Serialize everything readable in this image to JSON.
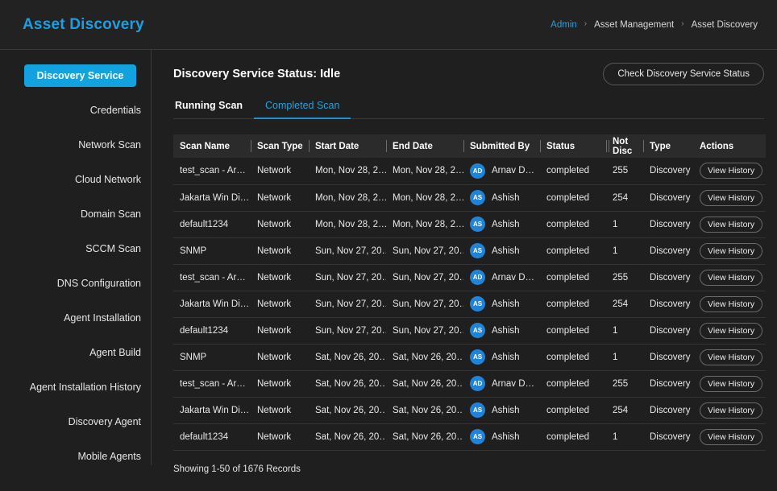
{
  "app": {
    "title": "Asset Discovery"
  },
  "breadcrumb": {
    "items": [
      "Admin",
      "Asset Management",
      "Asset Discovery"
    ],
    "separator": "›"
  },
  "sidebar": {
    "items": [
      {
        "label": "Discovery Service",
        "active": true
      },
      {
        "label": "Credentials",
        "active": false
      },
      {
        "label": "Network Scan",
        "active": false
      },
      {
        "label": "Cloud Network",
        "active": false
      },
      {
        "label": "Domain Scan",
        "active": false
      },
      {
        "label": "SCCM Scan",
        "active": false
      },
      {
        "label": "DNS Configuration",
        "active": false
      },
      {
        "label": "Agent Installation",
        "active": false
      },
      {
        "label": "Agent Build",
        "active": false
      },
      {
        "label": "Agent Installation History",
        "active": false
      },
      {
        "label": "Discovery Agent",
        "active": false
      },
      {
        "label": "Mobile Agents",
        "active": false
      }
    ]
  },
  "main": {
    "status_title": "Discovery Service Status: Idle",
    "check_button": "Check Discovery Service Status",
    "tabs": [
      {
        "label": "Running Scan",
        "active": false
      },
      {
        "label": "Completed Scan",
        "active": true
      }
    ],
    "footer_count": "Showing 1-50 of 1676 Records"
  },
  "table": {
    "columns": [
      "Scan Name",
      "Scan Type",
      "Start Date",
      "End Date",
      "Submitted By",
      "Status",
      "Not Disc",
      "Type",
      "Actions"
    ],
    "action_label": "View History",
    "rows": [
      {
        "scan_name": "test_scan - Ar…",
        "scan_type": "Network",
        "start_date": "Mon, Nov 28, 2…",
        "end_date": "Mon, Nov 28, 2…",
        "initials": "AD",
        "submitted_by": "Arnav D…",
        "status": "completed",
        "not_disc": "255",
        "type": "Discovery"
      },
      {
        "scan_name": "Jakarta Win Di…",
        "scan_type": "Network",
        "start_date": "Mon, Nov 28, 2…",
        "end_date": "Mon, Nov 28, 2…",
        "initials": "AS",
        "submitted_by": "Ashish",
        "status": "completed",
        "not_disc": "254",
        "type": "Discovery"
      },
      {
        "scan_name": "default1234",
        "scan_type": "Network",
        "start_date": "Mon, Nov 28, 2…",
        "end_date": "Mon, Nov 28, 2…",
        "initials": "AS",
        "submitted_by": "Ashish",
        "status": "completed",
        "not_disc": "1",
        "type": "Discovery"
      },
      {
        "scan_name": "SNMP",
        "scan_type": "Network",
        "start_date": "Sun, Nov 27, 20…",
        "end_date": "Sun, Nov 27, 20…",
        "initials": "AS",
        "submitted_by": "Ashish",
        "status": "completed",
        "not_disc": "1",
        "type": "Discovery"
      },
      {
        "scan_name": "test_scan - Ar…",
        "scan_type": "Network",
        "start_date": "Sun, Nov 27, 20…",
        "end_date": "Sun, Nov 27, 20…",
        "initials": "AD",
        "submitted_by": "Arnav D…",
        "status": "completed",
        "not_disc": "255",
        "type": "Discovery"
      },
      {
        "scan_name": "Jakarta Win Di…",
        "scan_type": "Network",
        "start_date": "Sun, Nov 27, 20…",
        "end_date": "Sun, Nov 27, 20…",
        "initials": "AS",
        "submitted_by": "Ashish",
        "status": "completed",
        "not_disc": "254",
        "type": "Discovery"
      },
      {
        "scan_name": "default1234",
        "scan_type": "Network",
        "start_date": "Sun, Nov 27, 20…",
        "end_date": "Sun, Nov 27, 20…",
        "initials": "AS",
        "submitted_by": "Ashish",
        "status": "completed",
        "not_disc": "1",
        "type": "Discovery"
      },
      {
        "scan_name": "SNMP",
        "scan_type": "Network",
        "start_date": "Sat, Nov 26, 20…",
        "end_date": "Sat, Nov 26, 20…",
        "initials": "AS",
        "submitted_by": "Ashish",
        "status": "completed",
        "not_disc": "1",
        "type": "Discovery"
      },
      {
        "scan_name": "test_scan - Ar…",
        "scan_type": "Network",
        "start_date": "Sat, Nov 26, 20…",
        "end_date": "Sat, Nov 26, 20…",
        "initials": "AD",
        "submitted_by": "Arnav D…",
        "status": "completed",
        "not_disc": "255",
        "type": "Discovery"
      },
      {
        "scan_name": "Jakarta Win Di…",
        "scan_type": "Network",
        "start_date": "Sat, Nov 26, 20…",
        "end_date": "Sat, Nov 26, 20…",
        "initials": "AS",
        "submitted_by": "Ashish",
        "status": "completed",
        "not_disc": "254",
        "type": "Discovery"
      },
      {
        "scan_name": "default1234",
        "scan_type": "Network",
        "start_date": "Sat, Nov 26, 20…",
        "end_date": "Sat, Nov 26, 20…",
        "initials": "AS",
        "submitted_by": "Ashish",
        "status": "completed",
        "not_disc": "1",
        "type": "Discovery"
      }
    ]
  },
  "colors": {
    "accent": "#12a2e0",
    "link": "#2a9fd8",
    "avatar": "#2083d8",
    "page_bg": "#1f1f1f",
    "header_row_bg": "#2b2b2b"
  }
}
